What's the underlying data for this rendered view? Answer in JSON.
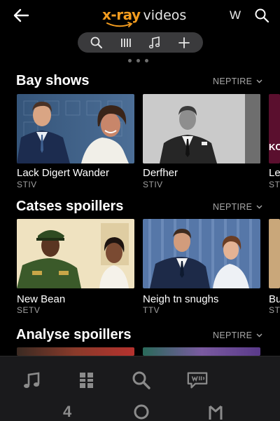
{
  "header": {
    "logo_primary": "x-ray",
    "logo_secondary": "videos",
    "w_label": "W"
  },
  "toolbar": {
    "items": [
      "search-icon",
      "bars-icon",
      "music-icon",
      "plus-icon"
    ]
  },
  "sections": [
    {
      "title": "Bay shows",
      "more_label": "NEPTIRE",
      "cards": [
        {
          "title": "Lack Digert Wander",
          "subtitle": "STIV"
        },
        {
          "title": "Derfher",
          "subtitle": "STIV"
        },
        {
          "title": "Le",
          "subtitle": "ST"
        }
      ]
    },
    {
      "title": "Catses spoillers",
      "more_label": "NEPTIRE",
      "cards": [
        {
          "title": "New Bean",
          "subtitle": "SETV"
        },
        {
          "title": "Neigh tn snughs",
          "subtitle": "TTV"
        },
        {
          "title": "Bu",
          "subtitle": "ST"
        }
      ]
    },
    {
      "title": "Analyse spoillers",
      "more_label": "NEPTIRE"
    }
  ],
  "card_overlay_text": "KC",
  "bottom_nav": {
    "items": [
      "music-note-icon",
      "grid-icon",
      "search-icon",
      "chat-icon"
    ],
    "number_label": "4",
    "accent": "#f39c1f"
  }
}
